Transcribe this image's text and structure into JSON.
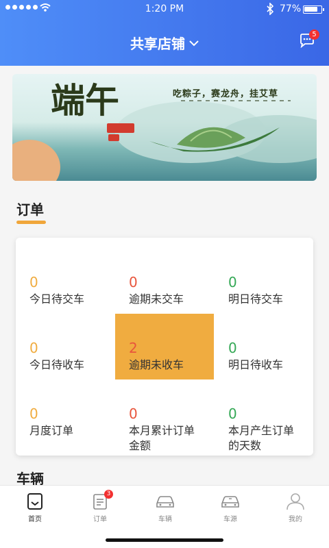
{
  "status_bar": {
    "time": "1:20 PM",
    "battery": "77%",
    "battery_level": 0.77
  },
  "header": {
    "title": "共享店铺",
    "message_badge": "5"
  },
  "banner": {
    "big_text": "端午",
    "small_text": "吃粽子，赛龙舟，挂艾草"
  },
  "orders_section": {
    "title": "订单"
  },
  "order_stats": [
    {
      "value": "0",
      "label": "今日待交车",
      "color": "orange"
    },
    {
      "value": "0",
      "label": "逾期未交车",
      "color": "red"
    },
    {
      "value": "0",
      "label": "明日待交车",
      "color": "green"
    },
    {
      "value": "0",
      "label": "今日待收车",
      "color": "orange"
    },
    {
      "value": "2",
      "label": "逾期未收车",
      "color": "red",
      "highlighted": true
    },
    {
      "value": "0",
      "label": "明日待收车",
      "color": "green"
    },
    {
      "value": "0",
      "label": "月度订单",
      "color": "orange"
    },
    {
      "value": "0",
      "label": "本月累计订单金额",
      "color": "red"
    },
    {
      "value": "0",
      "label": "本月产生订单的天数",
      "color": "green"
    }
  ],
  "vehicles_section": {
    "title": "车辆"
  },
  "tabbar": {
    "items": [
      {
        "label": "首页",
        "icon": "home-icon",
        "active": true
      },
      {
        "label": "订单",
        "icon": "order-icon",
        "badge": "3"
      },
      {
        "label": "车辆",
        "icon": "car-icon"
      },
      {
        "label": "车源",
        "icon": "car-source-icon"
      },
      {
        "label": "我的",
        "icon": "profile-icon"
      }
    ]
  },
  "colors": {
    "accent": "#f0ac40",
    "header_start": "#4f8ef8",
    "header_end": "#3a67e6",
    "red": "#e8553c",
    "green": "#35a856"
  }
}
